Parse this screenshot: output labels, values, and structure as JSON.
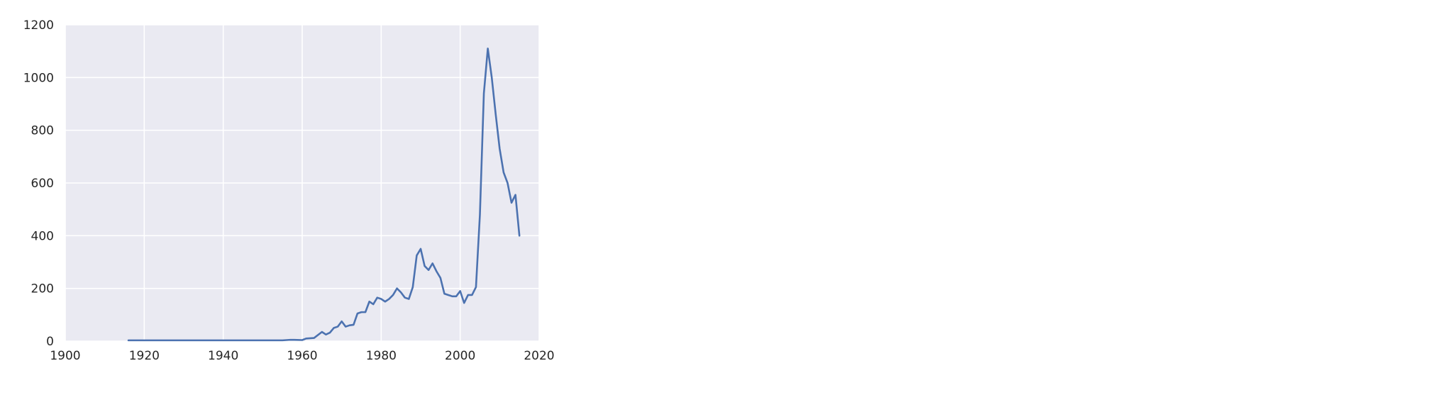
{
  "chart_data": {
    "type": "line",
    "title": "",
    "xlabel": "",
    "ylabel": "",
    "xlim": [
      1900,
      2020
    ],
    "ylim": [
      0,
      1200
    ],
    "x_ticks": [
      1900,
      1920,
      1940,
      1960,
      1980,
      2000,
      2020
    ],
    "y_ticks": [
      0,
      200,
      400,
      600,
      800,
      1000,
      1200
    ],
    "grid": true,
    "colors": {
      "background": "#eaeaf2",
      "grid": "#ffffff",
      "line": "#4c72b0"
    },
    "series": [
      {
        "x": [
          1916,
          1920,
          1925,
          1930,
          1935,
          1940,
          1945,
          1950,
          1955,
          1957,
          1958,
          1960,
          1961,
          1963,
          1965,
          1966,
          1967,
          1968,
          1969,
          1970,
          1971,
          1972,
          1973,
          1974,
          1975,
          1976,
          1977,
          1978,
          1979,
          1980,
          1981,
          1982,
          1983,
          1984,
          1985,
          1986,
          1987,
          1988,
          1989,
          1990,
          1991,
          1992,
          1993,
          1994,
          1995,
          1996,
          1997,
          1998,
          1999,
          2000,
          2001,
          2002,
          2003,
          2004,
          2005,
          2006,
          2007,
          2008,
          2009,
          2010,
          2011,
          2012,
          2013,
          2014,
          2015
        ],
        "y": [
          3,
          3,
          3,
          3,
          3,
          3,
          3,
          3,
          3,
          5,
          5,
          4,
          10,
          12,
          35,
          25,
          32,
          50,
          55,
          75,
          55,
          60,
          62,
          105,
          110,
          110,
          150,
          140,
          165,
          160,
          150,
          160,
          175,
          200,
          185,
          165,
          160,
          205,
          325,
          350,
          285,
          270,
          295,
          265,
          240,
          180,
          175,
          170,
          170,
          190,
          145,
          175,
          175,
          205,
          480,
          940,
          1110,
          1000,
          860,
          730,
          640,
          600,
          525,
          555,
          400
        ]
      }
    ]
  }
}
